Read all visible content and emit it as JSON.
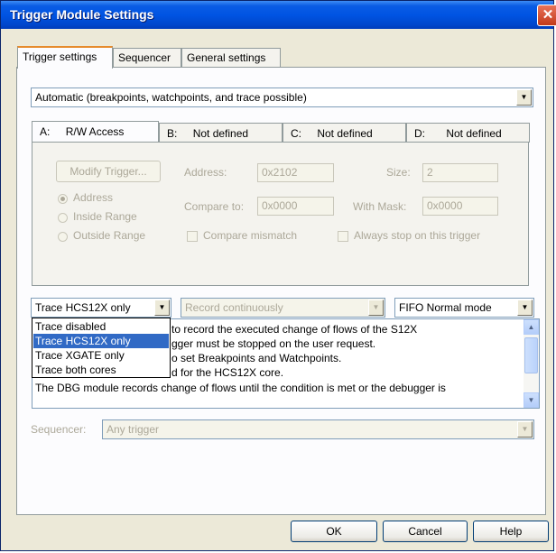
{
  "window": {
    "title": "Trigger Module Settings",
    "close_glyph": "✕"
  },
  "tabs": [
    {
      "label": "Trigger settings"
    },
    {
      "label": "Sequencer"
    },
    {
      "label": "General settings"
    }
  ],
  "mode_select": {
    "value": "Automatic (breakpoints, watchpoints, and trace possible)"
  },
  "subtabs": [
    {
      "letter": "A:",
      "label": "R/W Access"
    },
    {
      "letter": "B:",
      "label": "Not defined"
    },
    {
      "letter": "C:",
      "label": "Not defined"
    },
    {
      "letter": "D:",
      "label": "Not defined"
    }
  ],
  "trigger": {
    "modify_button": "Modify Trigger...",
    "address_label": "Address:",
    "address_value": "0x2102",
    "size_label": "Size:",
    "size_value": "2",
    "compare_label": "Compare to:",
    "compare_value": "0x0000",
    "mask_label": "With Mask:",
    "mask_value": "0x0000",
    "radio_address": "Address",
    "radio_inside": "Inside Range",
    "radio_outside": "Outside Range",
    "compare_mismatch": "Compare mismatch",
    "always_stop": "Always stop on this trigger"
  },
  "trace_select": {
    "value": "Trace HCS12X only"
  },
  "record_select": {
    "value": "Record continuously"
  },
  "fifo_select": {
    "value": "FIFO Normal mode"
  },
  "trace_options": [
    {
      "label": "Trace disabled",
      "selected": false
    },
    {
      "label": "Trace HCS12X only",
      "selected": true
    },
    {
      "label": "Trace XGATE only",
      "selected": false
    },
    {
      "label": "Trace both cores",
      "selected": false
    }
  ],
  "description_lines": [
    "to record the executed change of flows of the S12X",
    "gger must be stopped on the user request.",
    "o set Breakpoints and Watchpoints.",
    "d for the HCS12X core.",
    "The DBG module records change of flows until the condition is met or the debugger is"
  ],
  "sequencer": {
    "label": "Sequencer:",
    "value": "Any trigger"
  },
  "buttons": {
    "ok": "OK",
    "cancel": "Cancel",
    "help": "Help"
  },
  "icons": {
    "dropdown": "▼",
    "scroll_up": "▲",
    "scroll_down": "▼"
  }
}
